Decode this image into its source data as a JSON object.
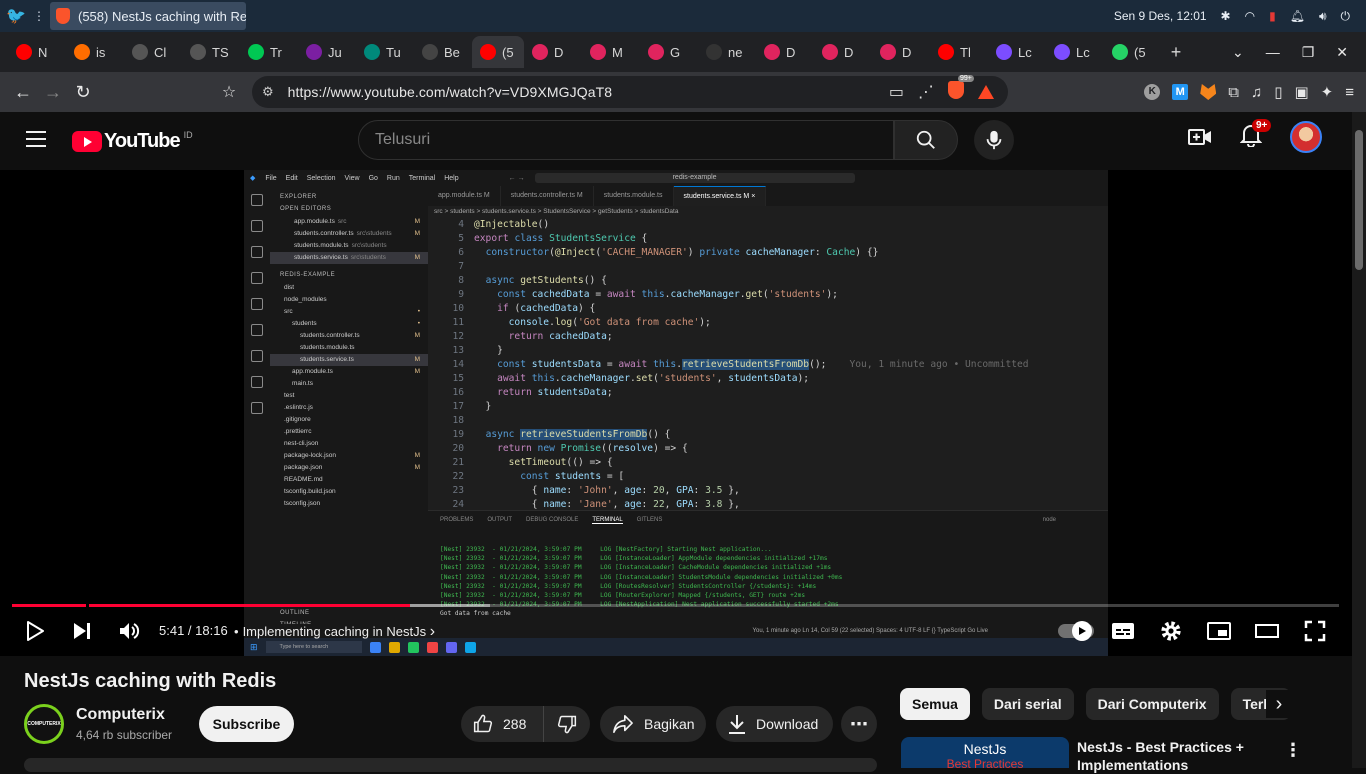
{
  "os": {
    "window_title": "(558) NestJs caching with Re...",
    "clock": "Sen  9 Des, 12:01"
  },
  "tabs": [
    {
      "label": "N",
      "color": "#ff0000"
    },
    {
      "label": "is",
      "color": "#ff6d00"
    },
    {
      "label": "Cl",
      "color": "#555555"
    },
    {
      "label": "TS",
      "color": "#555555"
    },
    {
      "label": "Tr",
      "color": "#00c853"
    },
    {
      "label": "Ju",
      "color": "#7b1fa2"
    },
    {
      "label": "Tu",
      "color": "#00897b"
    },
    {
      "label": "Be",
      "color": "#444444"
    },
    {
      "label": "(5",
      "color": "#ff0000",
      "active": true
    },
    {
      "label": "D",
      "color": "#e0245e"
    },
    {
      "label": "M",
      "color": "#e0245e"
    },
    {
      "label": "G",
      "color": "#e0245e"
    },
    {
      "label": "ne",
      "color": "#333333"
    },
    {
      "label": "D",
      "color": "#e0245e"
    },
    {
      "label": "D",
      "color": "#e0245e"
    },
    {
      "label": "D",
      "color": "#e0245e"
    },
    {
      "label": "Tl",
      "color": "#ff0000"
    },
    {
      "label": "Lc",
      "color": "#7c4dff"
    },
    {
      "label": "Lc",
      "color": "#7c4dff"
    },
    {
      "label": "(5",
      "color": "#25d366"
    }
  ],
  "browser": {
    "url": "https://www.youtube.com/watch?v=VD9XMGJQaT8",
    "shield_count": "99+",
    "ext_k": "K",
    "ext_m": "M"
  },
  "youtube": {
    "logo": "YouTube",
    "region": "ID",
    "search_placeholder": "Telusuri",
    "notif_badge": "9+"
  },
  "video_frame": {
    "menu": [
      "File",
      "Edit",
      "Selection",
      "View",
      "Go",
      "Run",
      "Terminal",
      "Help"
    ],
    "search": "redis-example",
    "explorer_label": "EXPLORER",
    "open_editors": "OPEN EDITORS",
    "project": "REDIS-EXAMPLE",
    "open_files": [
      {
        "name": "app.module.ts",
        "path": "src",
        "mark": "M"
      },
      {
        "name": "students.controller.ts",
        "path": "src\\students",
        "mark": "M"
      },
      {
        "name": "students.module.ts",
        "path": "src\\students",
        "mark": ""
      },
      {
        "name": "students.service.ts",
        "path": "src\\students",
        "mark": "M"
      }
    ],
    "tree": [
      {
        "name": "dist",
        "mark": ""
      },
      {
        "name": "node_modules",
        "mark": ""
      },
      {
        "name": "src",
        "mark": "•"
      },
      {
        "name": "students",
        "mark": "•"
      },
      {
        "name": "students.controller.ts",
        "mark": "M"
      },
      {
        "name": "students.module.ts",
        "mark": ""
      },
      {
        "name": "students.service.ts",
        "mark": "M"
      },
      {
        "name": "app.module.ts",
        "mark": "M"
      },
      {
        "name": "main.ts",
        "mark": ""
      },
      {
        "name": "test",
        "mark": ""
      },
      {
        "name": ".eslintrc.js",
        "mark": ""
      },
      {
        "name": ".gitignore",
        "mark": ""
      },
      {
        "name": ".prettierrc",
        "mark": ""
      },
      {
        "name": "nest-cli.json",
        "mark": ""
      },
      {
        "name": "package-lock.json",
        "mark": "M"
      },
      {
        "name": "package.json",
        "mark": "M"
      },
      {
        "name": "README.md",
        "mark": ""
      },
      {
        "name": "tsconfig.build.json",
        "mark": ""
      },
      {
        "name": "tsconfig.json",
        "mark": ""
      }
    ],
    "outline": "OUTLINE",
    "timeline": "TIMELINE",
    "editor_tabs": [
      "app.module.ts  M",
      "students.controller.ts  M",
      "students.module.ts",
      "students.service.ts  M  ×"
    ],
    "breadcrumb": "src > students > students.service.ts > StudentsService > getStudents > studentsData",
    "code_lines": [
      4,
      5,
      6,
      7,
      8,
      9,
      10,
      11,
      12,
      13,
      14,
      15,
      16,
      17,
      18,
      19,
      20,
      21,
      22,
      23,
      24
    ],
    "blame": "You, 1 minute ago • Uncommitted",
    "panel_tabs": [
      "PROBLEMS",
      "OUTPUT",
      "DEBUG CONSOLE",
      "TERMINAL",
      "GITLENS"
    ],
    "terminal_shell": "node",
    "terminal_lines": [
      "[Nest] 23932  - 01/21/2024, 3:59:07 PM     LOG [NestFactory] Starting Nest application...",
      "[Nest] 23932  - 01/21/2024, 3:59:07 PM     LOG [InstanceLoader] AppModule dependencies initialized +17ms",
      "[Nest] 23932  - 01/21/2024, 3:59:07 PM     LOG [InstanceLoader] CacheModule dependencies initialized +1ms",
      "[Nest] 23932  - 01/21/2024, 3:59:07 PM     LOG [InstanceLoader] StudentsModule dependencies initialized +0ms",
      "[Nest] 23932  - 01/21/2024, 3:59:07 PM     LOG [RoutesResolver] StudentsController {/students}: +14ms",
      "[Nest] 23932  - 01/21/2024, 3:59:07 PM     LOG [RouterExplorer] Mapped {/students, GET} route +2ms",
      "[Nest] 23932  - 01/21/2024, 3:59:07 PM     LOG [NestApplication] Nest application successfully started +2ms",
      "Got data from cache"
    ],
    "status_bar": "You, 1 minute ago    Ln 14, Col 59 (22 selected)    Spaces: 4    UTF-8    LF    {} TypeScript    Go Live",
    "win_search": "Type here to search"
  },
  "player": {
    "progress": 0.3,
    "buffered": 0.36,
    "time": "5:41 / 18:16",
    "chapter_sep": "•",
    "chapter": "Implementing caching in NestJs",
    "chapter_arrow": "›"
  },
  "meta": {
    "title": "NestJs caching with Redis",
    "channel": "Computerix",
    "channel_avatar_text": "COMPUTERIX",
    "subscribers": "4,64 rb subscriber",
    "subscribe": "Subscribe",
    "likes": "288",
    "share": "Bagikan",
    "download": "Download"
  },
  "sidebar": {
    "chips": [
      "Semua",
      "Dari serial",
      "Dari Computerix",
      "Terka"
    ],
    "rec_thumb_line1": "NestJs",
    "rec_thumb_line2": "Best Practices",
    "rec_title": "NestJs - Best Practices + Implementations"
  }
}
